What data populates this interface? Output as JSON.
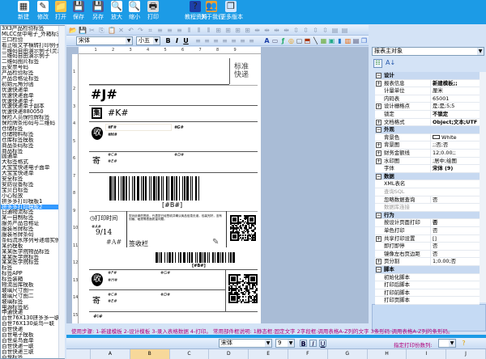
{
  "toolbar": {
    "buttons": [
      {
        "label": "新建",
        "icon": "new-grid-icon"
      },
      {
        "label": "修改",
        "icon": "edit-icon"
      },
      {
        "label": "打开",
        "icon": "folder-icon"
      },
      {
        "label": "保存",
        "icon": "save-icon"
      },
      {
        "label": "另存",
        "icon": "save-as-icon"
      },
      {
        "label": "放大",
        "icon": "zoom-in-icon"
      },
      {
        "label": "缩小",
        "icon": "zoom-out-icon"
      },
      {
        "label": "打印",
        "icon": "printer-icon"
      },
      {
        "label": "教程资料",
        "icon": "help-icon"
      },
      {
        "label": "关于我们",
        "icon": "users-icon"
      },
      {
        "label": "更多版本",
        "icon": "versions-icon"
      }
    ]
  },
  "template_list": {
    "selected": "拼多多打印模板2",
    "items": [
      "3X3产品检验标签",
      "MLCC盘中电子_外箱标签",
      "三口检验",
      "看止吸文字横转打印例子",
      "二维码自由演示例子(灵活)",
      "二维码自由演示例子",
      "二维码图片标签",
      "云安票号码",
      "产品检验标签",
      "产品合格证标签",
      "初始元角分函",
      "优速快递单",
      "优速快递面单",
      "优速快递单子",
      "优速快递单子副本",
      "优速快递880050",
      "保险人员保险牌标签",
      "保险牌条形码与二维码",
      "仓储标签",
      "仓储物料标签",
      "仓库标签模板",
      "商品条码标签",
      "商品标签",
      "圆通单",
      "大标签格式",
      "大宝宝快递电子面单",
      "大宝宝快递单",
      "安全标签",
      "安防设备标签",
      "宝贝白标签",
      "小心轻放",
      "拼多多打印模板1",
      "拼多多打印模板2",
      "日通物流标签",
      "某一自制标签",
      "服务产品合格证",
      "服装吊牌标签",
      "服装吊牌条码",
      "条码流水序列号递增实例",
      "某药模板",
      "某某医学院物品标签",
      "某某医学院标签",
      "某某医学院标签",
      "标签",
      "标签APP",
      "标签装箱",
      "物流出库模板",
      "玻璃尺寸图一",
      "玻璃尺寸图二",
      "玻璃标签",
      "电源标签贴",
      "申通快递",
      "百世76X130拼多多一联",
      "百世76X130菜鸟一联",
      "百世快递",
      "百世电子模板",
      "百世菜鸟面单",
      "百世快递一联",
      "百世快递三联",
      "百世标签"
    ]
  },
  "format_bar": {
    "font": "宋体",
    "size": "小五",
    "bold": "B",
    "italic": "I",
    "underline": "U"
  },
  "label": {
    "service": "标准快递",
    "J": "#J#",
    "collect_icon": "集",
    "K": "#K#",
    "recv_icon": "收",
    "F": "#F#",
    "G": "#G#",
    "H": "#H#",
    "send_icon": "寄",
    "C": "#C#",
    "D": "#D#",
    "E": "#E#",
    "barcode_text": "[#B#]",
    "print_time": "打印时间",
    "A_small": "#A#",
    "date": "9/14",
    "A": "#A#",
    "notice": "您对此单的签收，代表您已经签收并确认商品信息无误，包装完好，没有划痕、破损等表面质量问题。",
    "sign": "签收栏",
    "barcode_text2": "[#B#]",
    "I": "#I#"
  },
  "properties": {
    "object": "报表主对象",
    "rows": [
      {
        "k": "设计",
        "cat": true
      },
      {
        "k": "报表信息",
        "v": "新建模板;;",
        "ex": true,
        "bold": true
      },
      {
        "k": "计量单位",
        "v": "厘米"
      },
      {
        "k": "内码表",
        "v": "65001"
      },
      {
        "k": "设计栅格点",
        "v": "是;是;5;5",
        "ex": true
      },
      {
        "k": "锁定",
        "v": "不锁定",
        "bold": true
      },
      {
        "k": "文档格式",
        "v": "Object;文本;UTF",
        "ex": true,
        "bold": true
      },
      {
        "k": "外观",
        "cat": true
      },
      {
        "k": "背景色",
        "v": "White"
      },
      {
        "k": "背景图",
        "v": ";;否;否",
        "ex": true
      },
      {
        "k": "财务金额线",
        "v": "12;0.00;;",
        "ex": true
      },
      {
        "k": "水印图",
        "v": ";居中;绘图",
        "ex": true
      },
      {
        "k": "字体",
        "v": "宋体 (9)",
        "bold": true
      },
      {
        "k": "数据",
        "cat": true
      },
      {
        "k": "XML表名"
      },
      {
        "k": "查询SQL",
        "gray": true
      },
      {
        "k": "忽略数据查询",
        "v": "否"
      },
      {
        "k": "数据库连接",
        "gray": true
      },
      {
        "k": "行为",
        "cat": true
      },
      {
        "k": "按设计页面打印",
        "v": "否",
        "bold": true
      },
      {
        "k": "单色打印",
        "v": "否"
      },
      {
        "k": "共享打印设置",
        "v": "[]",
        "ex": true
      },
      {
        "k": "即打即停",
        "v": "否"
      },
      {
        "k": "镜像左右页边距",
        "v": "否"
      },
      {
        "k": "页分割",
        "v": "1;0.00;否",
        "ex": true
      },
      {
        "k": "脚本",
        "cat": true
      },
      {
        "k": "初始化脚本"
      },
      {
        "k": "打印后脚本"
      },
      {
        "k": "打印前脚本"
      },
      {
        "k": "打印页脚本"
      }
    ]
  },
  "instructions": "使用步骤: 1-新建模板 2-设计模板 3-录入表格数据 4-打印。 常用部件框说明: 1静态框:固定文字 2字段框:调用表格A-Z列的文字 3条形码:调用表格A-Z列的条形码。",
  "bottom_bar": {
    "font": "宋体",
    "size": "9",
    "bold": "B",
    "italic": "I",
    "underline": "U",
    "copies_label": "指定打印份数列:",
    "copies_value": ""
  },
  "sheet": {
    "columns": [
      "A",
      "B",
      "C",
      "D",
      "E",
      "F",
      "G",
      "H",
      "I",
      "J"
    ]
  },
  "colors": {
    "topbar": "#1c9be6",
    "selection": "#3399ff",
    "instructions": "#b0007a"
  }
}
